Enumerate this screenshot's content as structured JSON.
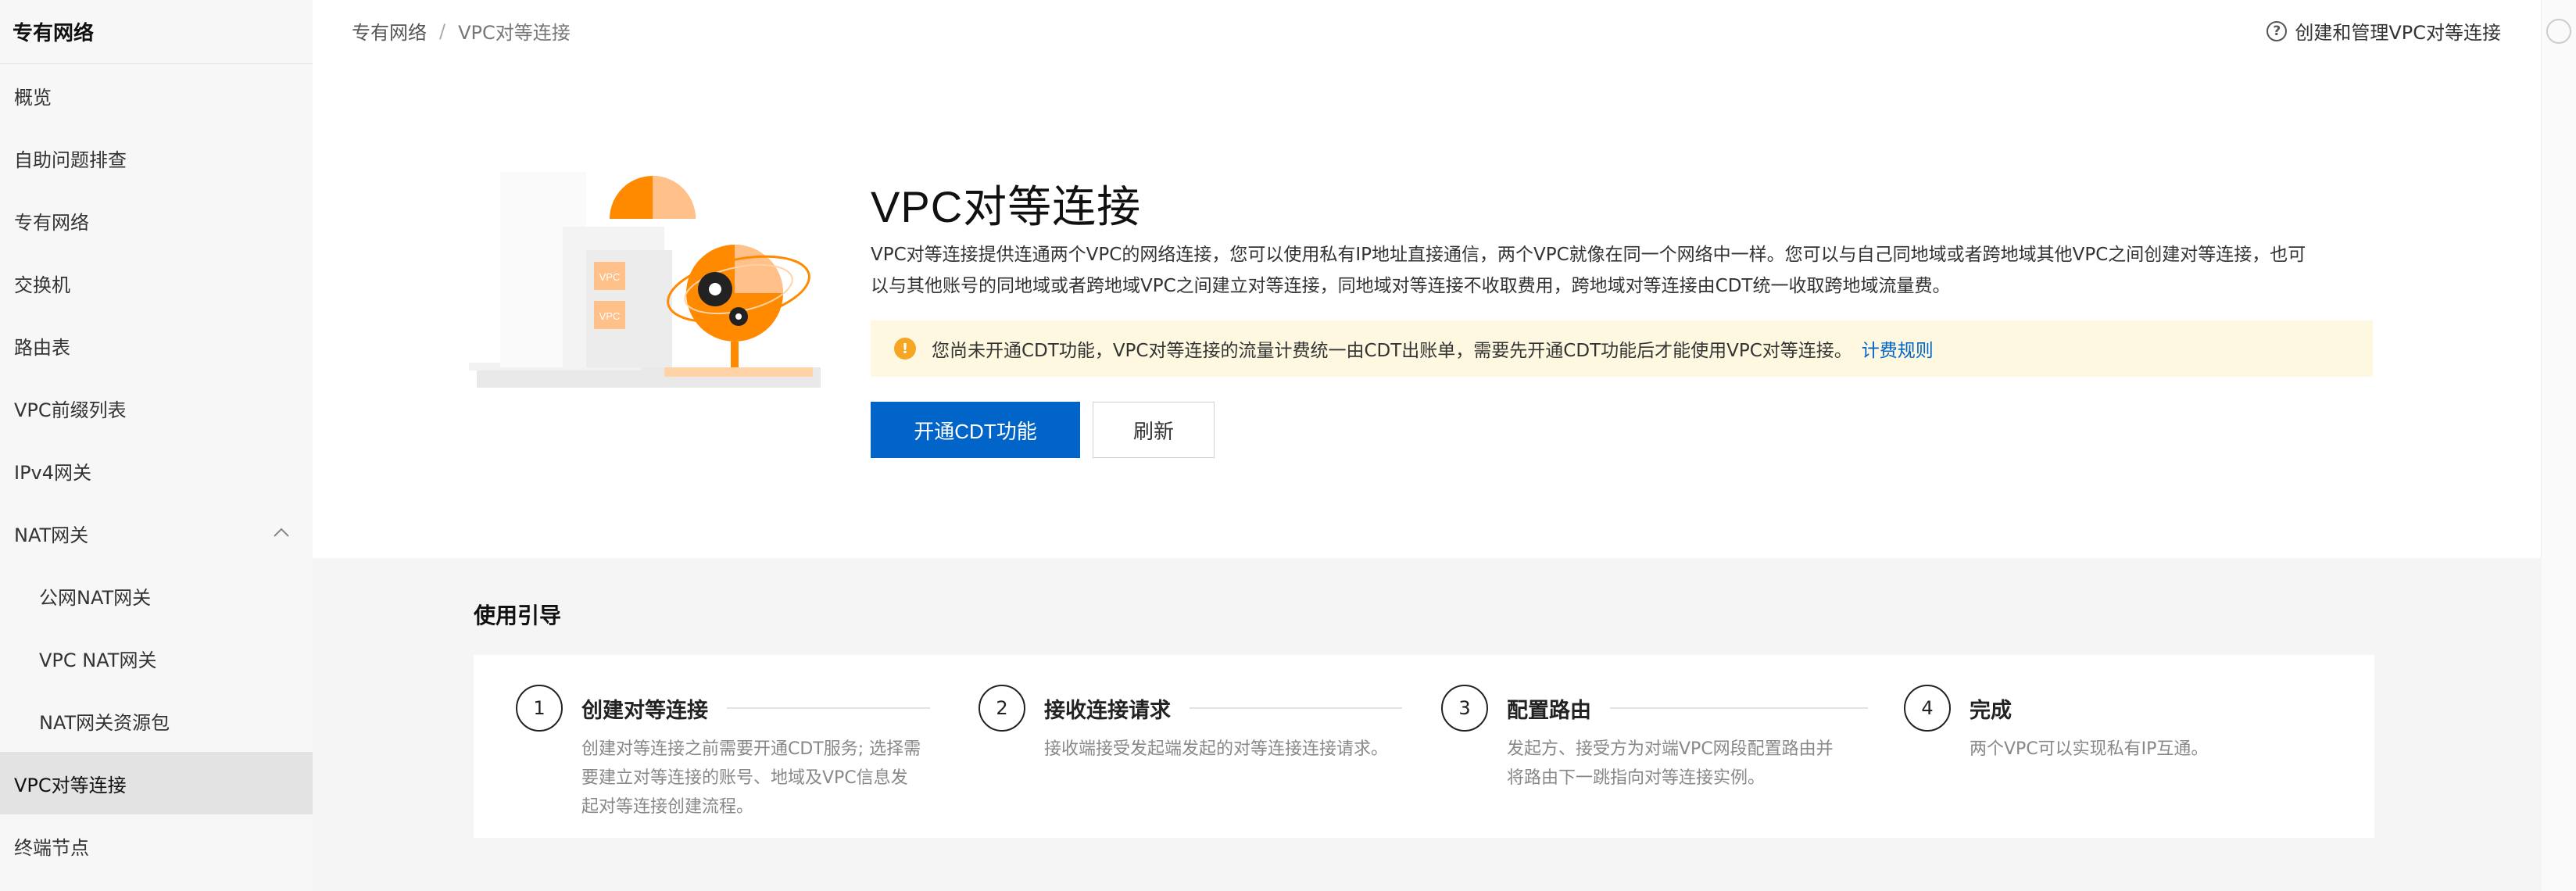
{
  "sidebar": {
    "title": "专有网络",
    "items": [
      {
        "label": "概览"
      },
      {
        "label": "自助问题排查"
      },
      {
        "label": "专有网络"
      },
      {
        "label": "交换机"
      },
      {
        "label": "路由表"
      },
      {
        "label": "VPC前缀列表"
      },
      {
        "label": "IPv4网关"
      },
      {
        "label": "NAT网关"
      },
      {
        "label": "公网NAT网关"
      },
      {
        "label": "VPC NAT网关"
      },
      {
        "label": "NAT网关资源包"
      },
      {
        "label": "VPC对等连接"
      },
      {
        "label": "终端节点"
      }
    ],
    "active_item": "VPC对等连接",
    "expanded_group": "NAT网关"
  },
  "breadcrumb": {
    "root": "专有网络",
    "separator": "/",
    "current": "VPC对等连接"
  },
  "help_link": {
    "label": "创建和管理VPC对等连接",
    "icon": "question-circle-icon"
  },
  "hero": {
    "title": "VPC对等连接",
    "description_line1": "VPC对等连接提供连通两个VPC的网络连接，您可以使用私有IP地址直接通信，两个VPC就像在同一个网络中一样。您可以与自己同地域或者跨地域其他VPC之间创建对等连接，也可",
    "description_line2": "以与其他账号的同地域或者跨地域VPC之间建立对等连接，同地域对等连接不收取费用，跨地域对等连接由CDT统一收取跨地域流量费。",
    "illustration_label_1": "VPC",
    "illustration_label_2": "VPC"
  },
  "notice": {
    "icon": "exclamation-circle-icon",
    "text": "您尚未开通CDT功能，VPC对等连接的流量计费统一由CDT出账单，需要先开通CDT功能后才能使用VPC对等连接。",
    "link": "计费规则"
  },
  "buttons": {
    "primary": "开通CDT功能",
    "secondary": "刷新"
  },
  "guide": {
    "title": "使用引导",
    "steps": [
      {
        "num": "1",
        "name": "创建对等连接",
        "desc_lines": [
          "创建对等连接之前需要开通CDT服务; 选择需",
          "要建立对等连接的账号、地域及VPC信息发",
          "起对等连接创建流程。"
        ]
      },
      {
        "num": "2",
        "name": "接收连接请求",
        "desc_lines": [
          "接收端接受发起端发起的对等连接连接请求。"
        ]
      },
      {
        "num": "3",
        "name": "配置路由",
        "desc_lines": [
          "发起方、接受方为对端VPC网段配置路由并",
          "将路由下一跳指向对等连接实例。"
        ]
      },
      {
        "num": "4",
        "name": "完成",
        "desc_lines": [
          "两个VPC可以实现私有IP互通。"
        ]
      }
    ]
  },
  "colors": {
    "primary": "#0064c8",
    "notice_bg": "#fff8e1",
    "warning": "#f5a623",
    "illustration_orange": "#ff8a00",
    "sidebar_bg": "#f7f7f7",
    "active_bg": "#e3e3e3"
  }
}
